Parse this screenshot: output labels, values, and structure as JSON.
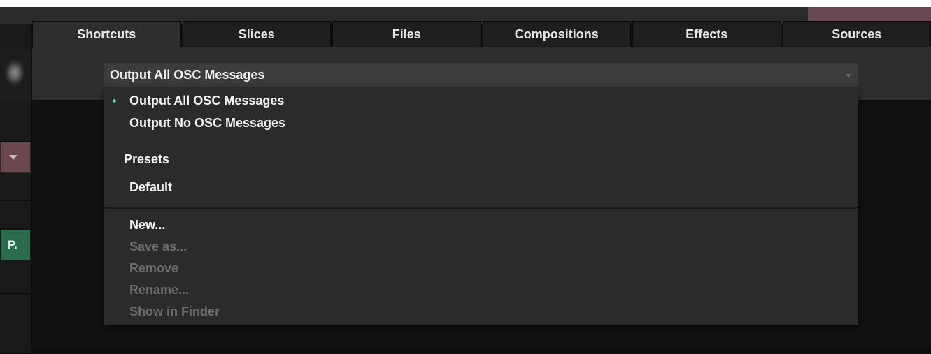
{
  "tabs": [
    {
      "label": "Shortcuts",
      "active": true
    },
    {
      "label": "Slices",
      "active": false
    },
    {
      "label": "Files",
      "active": false
    },
    {
      "label": "Compositions",
      "active": false
    },
    {
      "label": "Effects",
      "active": false
    },
    {
      "label": "Sources",
      "active": false
    }
  ],
  "left_strip": {
    "button_label": "P."
  },
  "dropdown": {
    "selected": "Output All OSC Messages",
    "options": [
      {
        "label": "Output All OSC Messages",
        "checked": true
      },
      {
        "label": "Output No OSC Messages",
        "checked": false
      }
    ],
    "presets_header": "Presets",
    "presets": [
      {
        "label": "Default"
      }
    ],
    "actions": [
      {
        "label": "New...",
        "enabled": true
      },
      {
        "label": "Save as...",
        "enabled": false
      },
      {
        "label": "Remove",
        "enabled": false
      },
      {
        "label": "Rename...",
        "enabled": false
      },
      {
        "label": "Show in Finder",
        "enabled": false
      }
    ]
  },
  "colors": {
    "accent_check": "#4fd3a6",
    "topbar_accent": "#6a4a52",
    "strip_dropdown": "#6b4850",
    "strip_button": "#2b6b4e"
  }
}
